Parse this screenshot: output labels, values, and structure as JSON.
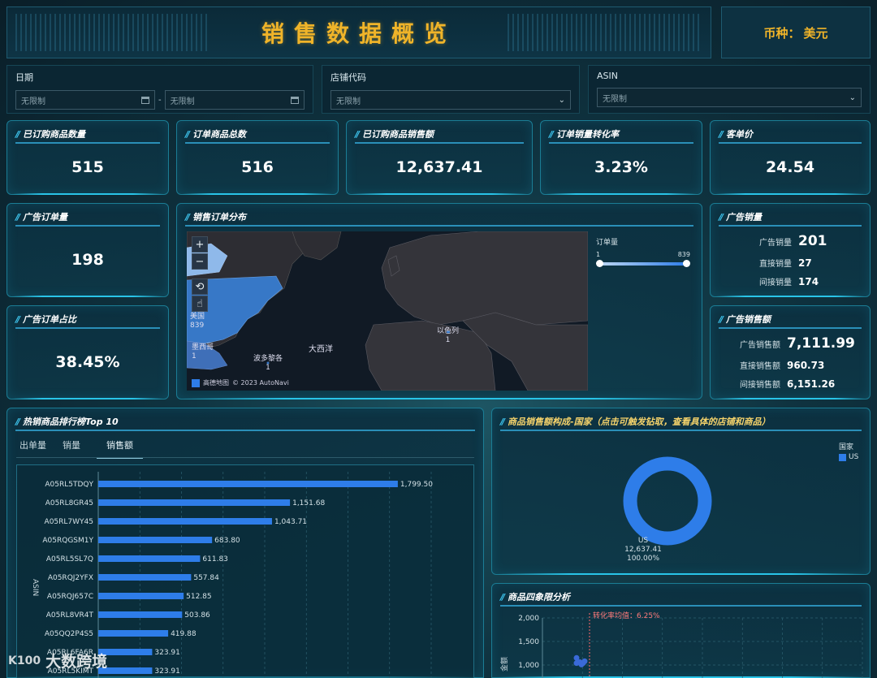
{
  "header": {
    "title": "销售数据概览",
    "currency_label": "币种：",
    "currency_value": "美元"
  },
  "filters": {
    "date": {
      "label": "日期",
      "start_placeholder": "无限制",
      "end_placeholder": "无限制",
      "separator": "-"
    },
    "store": {
      "label": "店铺代码",
      "value": "无限制"
    },
    "asin": {
      "label": "ASIN",
      "value": "无限制"
    }
  },
  "kpis": [
    {
      "title": "已订购商品数量",
      "value": "515"
    },
    {
      "title": "订单商品总数",
      "value": "516"
    },
    {
      "title": "已订购商品销售额",
      "value": "12,637.41"
    },
    {
      "title": "订单销量转化率",
      "value": "3.23%"
    },
    {
      "title": "客单价",
      "value": "24.54"
    }
  ],
  "ad_orders": {
    "title": "广告订单量",
    "value": "198"
  },
  "ad_order_ratio": {
    "title": "广告订单占比",
    "value": "38.45%"
  },
  "ad_sales_qty": {
    "title": "广告销量",
    "rows": [
      {
        "label": "广告销量",
        "value": "201"
      },
      {
        "label": "直接销量",
        "value": "27"
      },
      {
        "label": "间接销量",
        "value": "174"
      }
    ]
  },
  "ad_sales_amount": {
    "title": "广告销售额",
    "rows": [
      {
        "label": "广告销售额",
        "value": "7,111.99"
      },
      {
        "label": "直接销售额",
        "value": "960.73"
      },
      {
        "label": "间接销售额",
        "value": "6,151.26"
      }
    ]
  },
  "map": {
    "title": "销售订单分布",
    "legend_title": "订单量",
    "legend_min": "1",
    "legend_max": "839",
    "labels": [
      {
        "name": "美国",
        "value": "839"
      },
      {
        "name": "墨西哥",
        "value": "1"
      },
      {
        "name": "波多黎各",
        "value": "1"
      },
      {
        "name": "以色列",
        "value": "1"
      },
      {
        "name": "大西洋",
        "value": ""
      }
    ],
    "attribution_brand": "高德地图",
    "attribution_copy": "© 2023 AutoNavi",
    "zoom_in": "+",
    "zoom_out": "−",
    "reset_icon": "⟲",
    "pointer_icon": "☝"
  },
  "top10": {
    "title": "热销商品排行榜Top 10",
    "tabs": [
      "出单量",
      "销量",
      "销售额"
    ],
    "active_tab": 2,
    "y_axis_label": "ASIN"
  },
  "chart_data": [
    {
      "type": "bar",
      "orientation": "horizontal",
      "categories": [
        "A05RL5TDQY",
        "A05RL8GR45",
        "A05RL7WY45",
        "A05RQGSM1Y",
        "A05RL5SL7Q",
        "A05RQJ2YFX",
        "A05RQJ657C",
        "A05RL8VR4T",
        "A05QQ2P4S5",
        "A05RL6FA6R",
        "A05RL5KIMT"
      ],
      "values": [
        1799.5,
        1151.68,
        1043.71,
        683.8,
        611.83,
        557.84,
        512.85,
        503.86,
        419.88,
        323.91,
        323.91
      ],
      "value_labels": [
        "1,799.50",
        "1,151.68",
        "1,043.71",
        "683.80",
        "611.83",
        "557.84",
        "512.85",
        "503.86",
        "419.88",
        "323.91",
        "323.91"
      ],
      "ylabel": "ASIN",
      "xlim": [
        0,
        2000
      ],
      "color": "#2e7de9",
      "grid": true
    },
    {
      "type": "pie",
      "title": "商品销售额构成-国家（点击可触发钻取，查看具体的店铺和商品）",
      "legend_title": "国家",
      "legend_position": "top-right",
      "slices": [
        {
          "name": "US",
          "value": 12637.41,
          "value_label": "12,637.41",
          "percent_label": "100.00%"
        }
      ],
      "color": "#2e7de9"
    },
    {
      "type": "scatter",
      "title": "商品四象限分析",
      "y_ticks": [
        "2,000",
        "1,500",
        "1,000"
      ],
      "ylim": [
        0,
        2000
      ],
      "ylabel": "金额",
      "reference_line_label": "转化率均值：6.25%",
      "points": [
        {
          "x": 0.1,
          "y": 1150
        },
        {
          "x": 0.1,
          "y": 1040
        },
        {
          "x": 0.3,
          "y": 1060
        },
        {
          "x": 0.5,
          "y": 1040
        },
        {
          "x": 0.4,
          "y": 1010
        },
        {
          "x": 0.6,
          "y": 1080
        }
      ]
    }
  ],
  "watermark": {
    "logo": "K100",
    "text": "大数跨境"
  },
  "colors": {
    "accent": "#29c4e8",
    "gold": "#f0b429",
    "bar": "#2e7de9"
  }
}
